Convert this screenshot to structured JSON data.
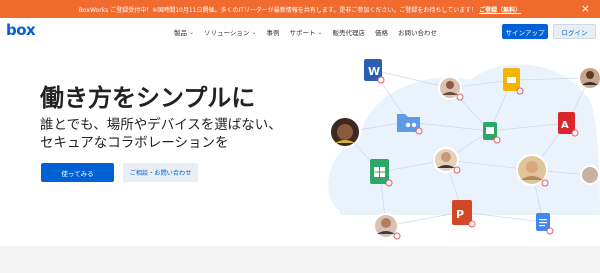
{
  "banner": {
    "text": "BoxWorks ご登録受付中！※国時間10月11日開催。多くのITリーダーが最新情報を共有します。是非ご参加ください。ご登録をお待ちしています！",
    "link": "ご登録（無料）",
    "close_glyph": "×",
    "color": "#f16b2e"
  },
  "nav": {
    "logo": "box",
    "items": [
      {
        "label": "製品",
        "dropdown": true
      },
      {
        "label": "ソリューション",
        "dropdown": true
      },
      {
        "label": "事例",
        "dropdown": false
      },
      {
        "label": "サポート",
        "dropdown": true
      },
      {
        "label": "販売代理店",
        "dropdown": false
      },
      {
        "label": "価格",
        "dropdown": false
      },
      {
        "label": "お問い合わせ",
        "dropdown": false
      }
    ],
    "signup": "サインアップ",
    "login": "ログイン"
  },
  "hero": {
    "headline": "働き方をシンプルに",
    "sub_line1": "誰とでも、場所やデバイスを選ばない、",
    "sub_line2": "セキュアなコラボレーションを",
    "try_button": "使ってみる",
    "contact_button": "ご相談・お問い合わせ"
  },
  "network": {
    "icons": [
      "word-doc-icon",
      "google-slides-icon",
      "folder-icon",
      "google-sheets-icon",
      "pdf-icon",
      "spreadsheet-icon",
      "powerpoint-icon",
      "google-docs-icon"
    ],
    "avatars": 7
  },
  "colors": {
    "brand": "#0061d5",
    "banner": "#f16b2e"
  }
}
